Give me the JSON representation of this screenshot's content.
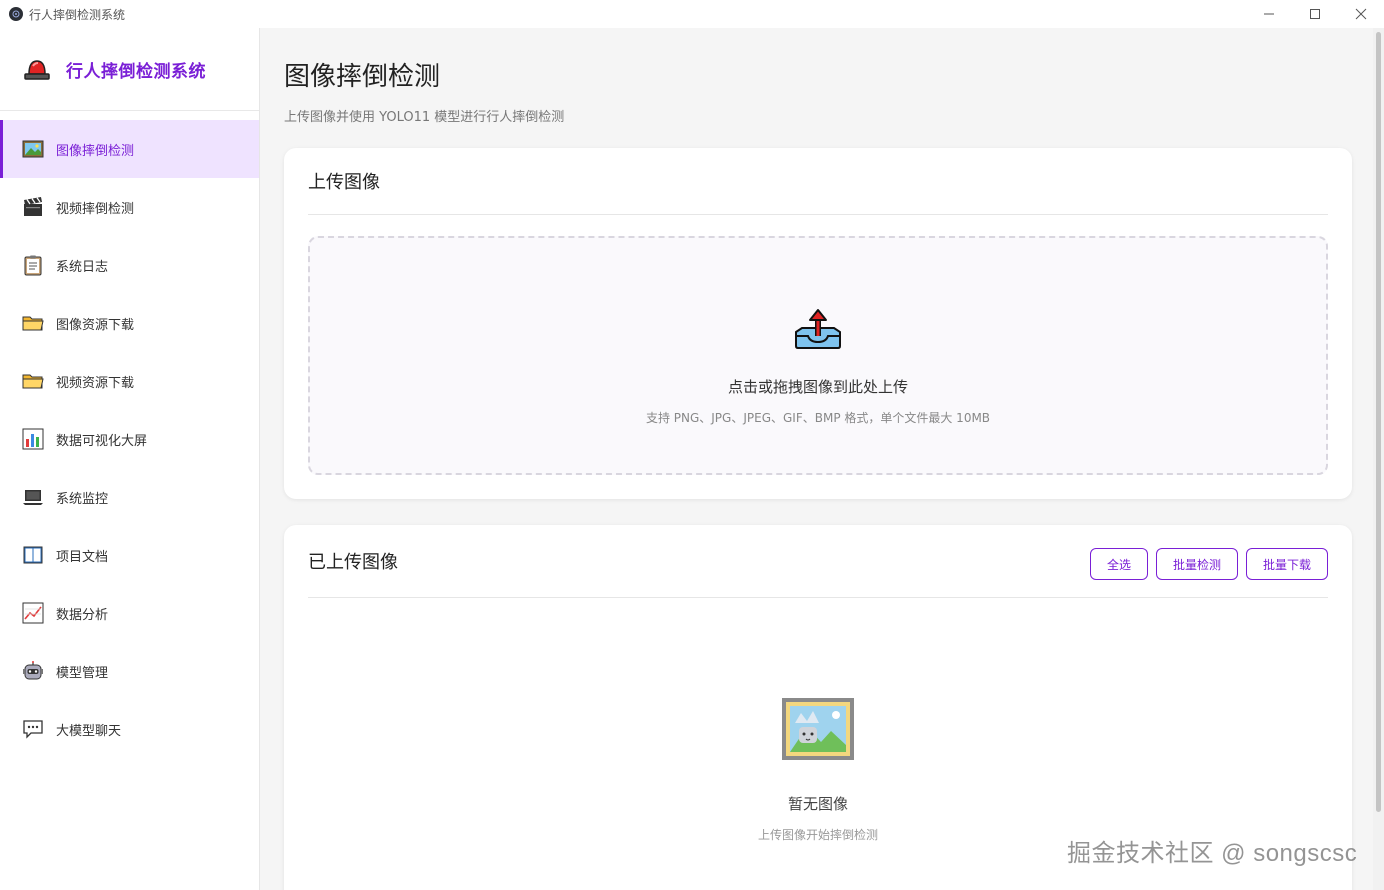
{
  "window": {
    "title": "行人摔倒检测系统"
  },
  "sidebar": {
    "brand": "行人摔倒检测系统",
    "items": [
      {
        "label": "图像摔倒检测",
        "icon": "picture-icon",
        "active": true
      },
      {
        "label": "视频摔倒检测",
        "icon": "clapper-icon",
        "active": false
      },
      {
        "label": "系统日志",
        "icon": "clipboard-icon",
        "active": false
      },
      {
        "label": "图像资源下载",
        "icon": "folder-icon",
        "active": false
      },
      {
        "label": "视频资源下载",
        "icon": "folder-icon",
        "active": false
      },
      {
        "label": "数据可视化大屏",
        "icon": "bar-chart-icon",
        "active": false
      },
      {
        "label": "系统监控",
        "icon": "laptop-icon",
        "active": false
      },
      {
        "label": "项目文档",
        "icon": "book-icon",
        "active": false
      },
      {
        "label": "数据分析",
        "icon": "line-chart-icon",
        "active": false
      },
      {
        "label": "模型管理",
        "icon": "robot-icon",
        "active": false
      },
      {
        "label": "大模型聊天",
        "icon": "chat-icon",
        "active": false
      }
    ]
  },
  "main": {
    "title": "图像摔倒检测",
    "subtitle": "上传图像并使用 YOLO11 模型进行行人摔倒检测",
    "upload_card": {
      "title": "上传图像",
      "drop_text": "点击或拖拽图像到此处上传",
      "drop_hint": "支持 PNG、JPG、JPEG、GIF、BMP 格式，单个文件最大 10MB"
    },
    "uploaded_card": {
      "title": "已上传图像",
      "buttons": {
        "select_all": "全选",
        "batch_detect": "批量检测",
        "batch_download": "批量下载"
      },
      "empty_title": "暂无图像",
      "empty_hint": "上传图像开始摔倒检测"
    }
  },
  "watermark": "掘金技术社区 @ songscsc",
  "colors": {
    "accent": "#7a1fd6",
    "active_bg": "#efe3ff"
  }
}
